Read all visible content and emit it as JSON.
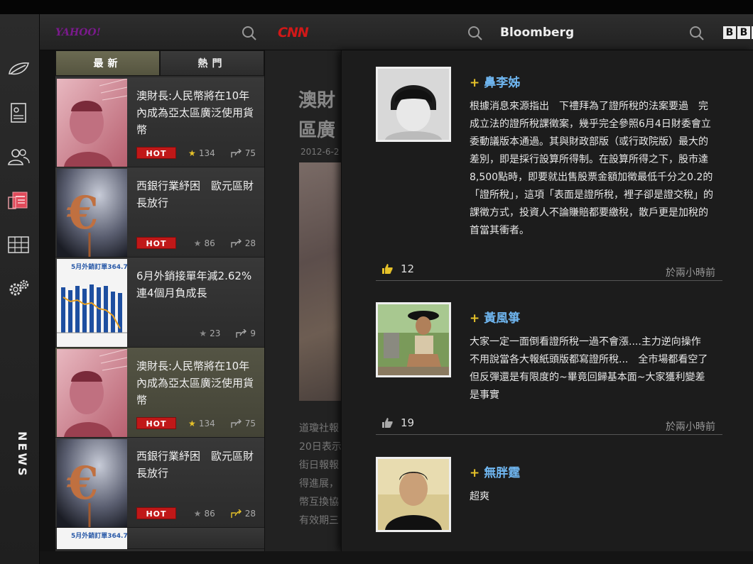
{
  "sources": {
    "yahoo": "YAHOO!",
    "cnn": "CNN",
    "bloomberg": "Bloomberg",
    "bbc": [
      "B",
      "B",
      "C"
    ]
  },
  "sidebar": {
    "items": [
      {
        "icon": "home-leaf-icon"
      },
      {
        "icon": "profile-card-icon"
      },
      {
        "icon": "users-icon"
      },
      {
        "icon": "newspaper-icon"
      },
      {
        "icon": "grid-table-icon"
      },
      {
        "icon": "settings-gears-icon"
      }
    ],
    "section_label": "NEWS"
  },
  "tabs": [
    {
      "label": "最新",
      "active": true
    },
    {
      "label": "熱門",
      "active": false
    }
  ],
  "articles": [
    {
      "title": "澳財長:人民幣將在10年內成為亞太區廣泛使用貨幣",
      "hot": "HOT",
      "stars": "134",
      "shares": "75",
      "thumb": "yuan"
    },
    {
      "title": "西銀行業紓困　歐元區財長放行",
      "hot": "HOT",
      "stars": "86",
      "shares": "28",
      "thumb": "euro"
    },
    {
      "title": "6月外銷接單年減2.62%連4個月負成長",
      "hot": "",
      "stars": "23",
      "shares": "9",
      "thumb": "chart",
      "thumb_title": "5月外銷訂單364.7("
    },
    {
      "title": "澳財長:人民幣將在10年內成為亞太區廣泛使用貨幣",
      "hot": "HOT",
      "stars": "134",
      "shares": "75",
      "thumb": "yuan",
      "selected": true
    },
    {
      "title": "西銀行業紓困　歐元區財長放行",
      "hot": "HOT",
      "stars": "86",
      "shares": "28",
      "thumb": "euro"
    }
  ],
  "partial_thumb_title": "5月外銷訂單364.7(",
  "detail": {
    "title": "澳財區廣",
    "date": "2012-6-2",
    "body": [
      "道瓊社報",
      "20日表示",
      "街日報報",
      "得進展，",
      "幣互換協",
      "有效期三"
    ]
  },
  "comments": [
    {
      "name": "鼻李姊",
      "text": "根據消息來源指出　下禮拜為了證所稅的法案要過　完成立法的證所稅課徵案，幾乎完全參照6月4日財委會立委動議版本通過。其與財政部版（或行政院版）最大的差別，即是採行設算所得制。在設算所得之下，股市達8,500點時，即要就出售股票金額加徵最低千分之0.2的「證所稅」，這項「表面是證所稅，裡子卻是證交稅」的課徵方式，投資人不論賺賠都要繳稅，散戶更是加稅的首當其衝者。",
      "likes": "12",
      "time": "於兩小時前"
    },
    {
      "name": "黃風箏",
      "text": "大家一定一面倒看證所稅一過不會漲....主力逆向操作　不用說當各大報紙頭版都寫證所稅...　全市場都看空了　但反彈還是有限度的~畢竟回歸基本面~大家獲利變差是事實",
      "likes": "19",
      "time": "於兩小時前"
    },
    {
      "name": "無胖霆",
      "text": "超爽",
      "likes": "",
      "time": ""
    }
  ],
  "colors": {
    "accent_name": "#6fb6f0",
    "hot_red": "#c01818",
    "tab_active": "#6b6a52",
    "plus_yellow": "#e6c229"
  }
}
